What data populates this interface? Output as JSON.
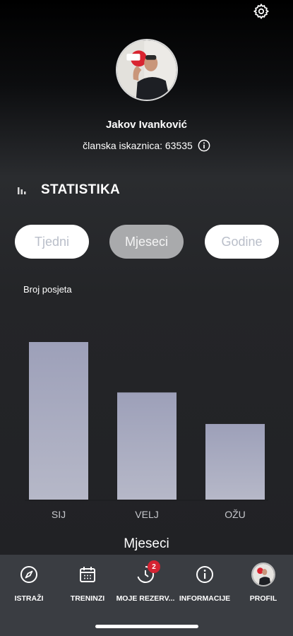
{
  "profile": {
    "name": "Jakov Ivanković",
    "member_card": "članska iskaznica: 63535"
  },
  "stats": {
    "title": "STATISTIKA",
    "tabs": [
      "Tjedni",
      "Mjeseci",
      "Godine"
    ],
    "active_tab": "Mjeseci"
  },
  "chart_data": {
    "type": "bar",
    "ylabel": "Broj posjeta",
    "xlabel": "Mjeseci",
    "categories": [
      "SIJ",
      "VELJ",
      "OŽU"
    ],
    "values": [
      10,
      6.8,
      4.8
    ],
    "ylim": [
      0,
      10
    ],
    "bar_color": "#a9acbf"
  },
  "nav": {
    "items": [
      {
        "label": "ISTRAŽI",
        "icon": "compass-icon"
      },
      {
        "label": "TRENINZI",
        "icon": "calendar-icon"
      },
      {
        "label": "MOJE REZERV...",
        "icon": "clock-icon",
        "badge": "2"
      },
      {
        "label": "INFORMACIJE",
        "icon": "info-icon"
      },
      {
        "label": "PROFIL",
        "icon": "avatar"
      }
    ]
  }
}
